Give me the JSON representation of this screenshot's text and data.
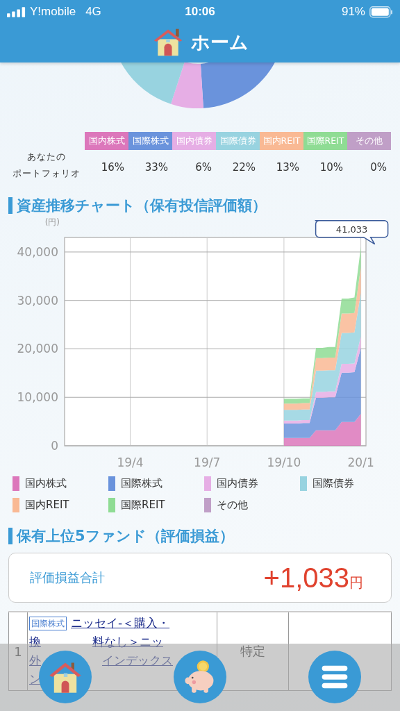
{
  "status_bar": {
    "carrier": "Y!mobile",
    "network": "4G",
    "time": "10:06",
    "battery": "91%"
  },
  "header": {
    "title": "ホーム"
  },
  "portfolio": {
    "label_lines": [
      "あなたの",
      "ポートフォリオ"
    ],
    "items": [
      {
        "name": "国内株式",
        "color": "#dc77bb",
        "percent": "16%"
      },
      {
        "name": "国際株式",
        "color": "#6a93dc",
        "percent": "33%"
      },
      {
        "name": "国内債券",
        "color": "#e6aee5",
        "percent": "6%"
      },
      {
        "name": "国際債券",
        "color": "#98d3e0",
        "percent": "22%"
      },
      {
        "name": "国内REIT",
        "color": "#f9b994",
        "percent": "13%"
      },
      {
        "name": "国際REIT",
        "color": "#8fdc94",
        "percent": "10%"
      },
      {
        "name": "その他",
        "color": "#c09fc7",
        "percent": "0%"
      }
    ]
  },
  "asset_chart": {
    "title": "資産推移チャート（保有投信評価額）",
    "unit": "(円)",
    "chart_data": {
      "type": "area",
      "stacked": true,
      "grid": true,
      "categories": [
        null,
        null,
        null,
        null,
        null,
        null,
        null,
        null,
        null,
        null,
        null,
        null,
        "19/4",
        null,
        null,
        null,
        null,
        null,
        null,
        null,
        null,
        null,
        null,
        null,
        "19/7",
        null,
        null,
        null,
        null,
        null,
        null,
        null,
        null,
        null,
        null,
        null,
        "19/10",
        null,
        null,
        null,
        null,
        null,
        null,
        null,
        null,
        null,
        null,
        null,
        "20/1"
      ],
      "ylim": [
        0,
        43000
      ],
      "yticks": [
        {
          "value": 0,
          "label": "0"
        },
        {
          "value": 10000,
          "label": "10,000"
        },
        {
          "value": 20000,
          "label": "20,000"
        },
        {
          "value": 30000,
          "label": "30,000"
        },
        {
          "value": 40000,
          "label": "40,000"
        }
      ],
      "series": [
        {
          "name": "国内株式",
          "color": "#dc77bb",
          "values": [
            null,
            null,
            null,
            null,
            null,
            null,
            null,
            null,
            null,
            null,
            null,
            null,
            null,
            null,
            null,
            null,
            null,
            null,
            null,
            null,
            null,
            null,
            null,
            null,
            null,
            null,
            null,
            null,
            null,
            null,
            null,
            null,
            null,
            null,
            null,
            null,
            1600,
            1600,
            1600,
            1600,
            1600,
            3200,
            3200,
            3200,
            3200,
            4900,
            4900,
            4900,
            6600
          ]
        },
        {
          "name": "国際株式",
          "color": "#6a93dc",
          "values": [
            null,
            null,
            null,
            null,
            null,
            null,
            null,
            null,
            null,
            null,
            null,
            null,
            null,
            null,
            null,
            null,
            null,
            null,
            null,
            null,
            null,
            null,
            null,
            null,
            null,
            null,
            null,
            null,
            null,
            null,
            null,
            null,
            null,
            null,
            null,
            null,
            3000,
            3000,
            3000,
            3100,
            3100,
            6700,
            6700,
            6800,
            6800,
            10200,
            10200,
            10300,
            13600
          ]
        },
        {
          "name": "国内債券",
          "color": "#e6aee5",
          "values": [
            null,
            null,
            null,
            null,
            null,
            null,
            null,
            null,
            null,
            null,
            null,
            null,
            null,
            null,
            null,
            null,
            null,
            null,
            null,
            null,
            null,
            null,
            null,
            null,
            null,
            null,
            null,
            null,
            null,
            null,
            null,
            null,
            null,
            null,
            null,
            null,
            600,
            600,
            600,
            600,
            600,
            1200,
            1200,
            1200,
            1200,
            1800,
            1800,
            1800,
            2400
          ]
        },
        {
          "name": "国際債券",
          "color": "#98d3e0",
          "values": [
            null,
            null,
            null,
            null,
            null,
            null,
            null,
            null,
            null,
            null,
            null,
            null,
            null,
            null,
            null,
            null,
            null,
            null,
            null,
            null,
            null,
            null,
            null,
            null,
            null,
            null,
            null,
            null,
            null,
            null,
            null,
            null,
            null,
            null,
            null,
            null,
            2200,
            2200,
            2200,
            2200,
            2200,
            4400,
            4400,
            4400,
            4400,
            6400,
            6400,
            6400,
            9000
          ]
        },
        {
          "name": "国内REIT",
          "color": "#f9b994",
          "values": [
            null,
            null,
            null,
            null,
            null,
            null,
            null,
            null,
            null,
            null,
            null,
            null,
            null,
            null,
            null,
            null,
            null,
            null,
            null,
            null,
            null,
            null,
            null,
            null,
            null,
            null,
            null,
            null,
            null,
            null,
            null,
            null,
            null,
            null,
            null,
            null,
            1300,
            1300,
            1300,
            1300,
            1300,
            2600,
            2600,
            2600,
            2600,
            4000,
            4000,
            4000,
            5300
          ]
        },
        {
          "name": "国際REIT",
          "color": "#8fdc94",
          "values": [
            null,
            null,
            null,
            null,
            null,
            null,
            null,
            null,
            null,
            null,
            null,
            null,
            null,
            null,
            null,
            null,
            null,
            null,
            null,
            null,
            null,
            null,
            null,
            null,
            null,
            null,
            null,
            null,
            null,
            null,
            null,
            null,
            null,
            null,
            null,
            null,
            1000,
            1000,
            1000,
            1000,
            1000,
            2100,
            2100,
            2200,
            2200,
            3100,
            3100,
            3200,
            4133
          ]
        },
        {
          "name": "その他",
          "color": "#c09fc7",
          "values": [
            null,
            null,
            null,
            null,
            null,
            null,
            null,
            null,
            null,
            null,
            null,
            null,
            null,
            null,
            null,
            null,
            null,
            null,
            null,
            null,
            null,
            null,
            null,
            null,
            null,
            null,
            null,
            null,
            null,
            null,
            null,
            null,
            null,
            null,
            null,
            null,
            null,
            null,
            null,
            null,
            null,
            null,
            null,
            null,
            null,
            null,
            null,
            null,
            null
          ]
        }
      ],
      "annotations": [
        {
          "x": "20/1",
          "y": 41033,
          "text": "41,033"
        }
      ]
    }
  },
  "top_funds": {
    "title": "保有上位5ファンド（評価損益）",
    "total_label": "評価損益合計",
    "total_value": "+1,033",
    "total_unit": "円",
    "rows": [
      {
        "rank": "1",
        "category": "国際株式",
        "name_lines": [
          [
            "ニッセイ-＜購入・"
          ],
          [
            "換",
            "料なし＞ニッ"
          ],
          [
            "外",
            "インデックス"
          ],
          [
            "ン"
          ]
        ],
        "account": "特定"
      }
    ]
  },
  "bottom_nav": [
    {
      "kind": "home"
    },
    {
      "kind": "savings"
    },
    {
      "kind": "menu"
    }
  ]
}
